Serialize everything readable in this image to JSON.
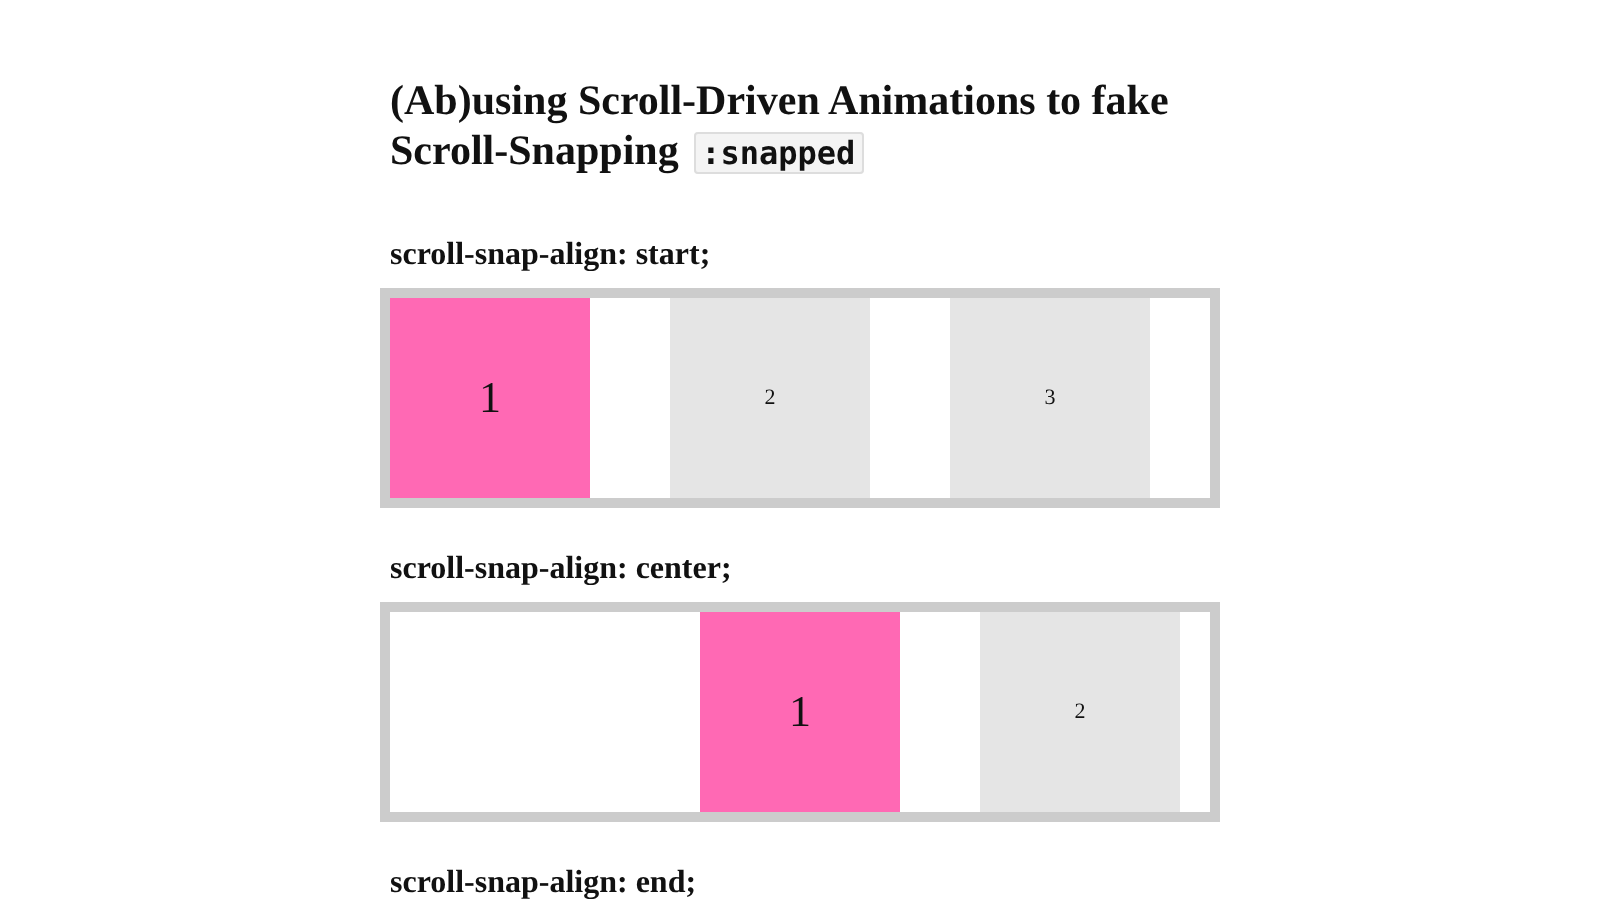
{
  "title": {
    "text": "(Ab)using Scroll-Driven Animations to fake Scroll-Snapping",
    "code": ":snapped"
  },
  "demos": [
    {
      "heading": "scroll-snap-align: start;",
      "kind": "start",
      "items": [
        {
          "label": "1",
          "selected": true
        },
        {
          "label": "2",
          "selected": false
        },
        {
          "label": "3",
          "selected": false
        }
      ]
    },
    {
      "heading": "scroll-snap-align: center;",
      "kind": "center",
      "items": [
        {
          "label": "1",
          "selected": true
        },
        {
          "label": "2",
          "selected": false
        }
      ]
    },
    {
      "heading": "scroll-snap-align: end;"
    }
  ]
}
